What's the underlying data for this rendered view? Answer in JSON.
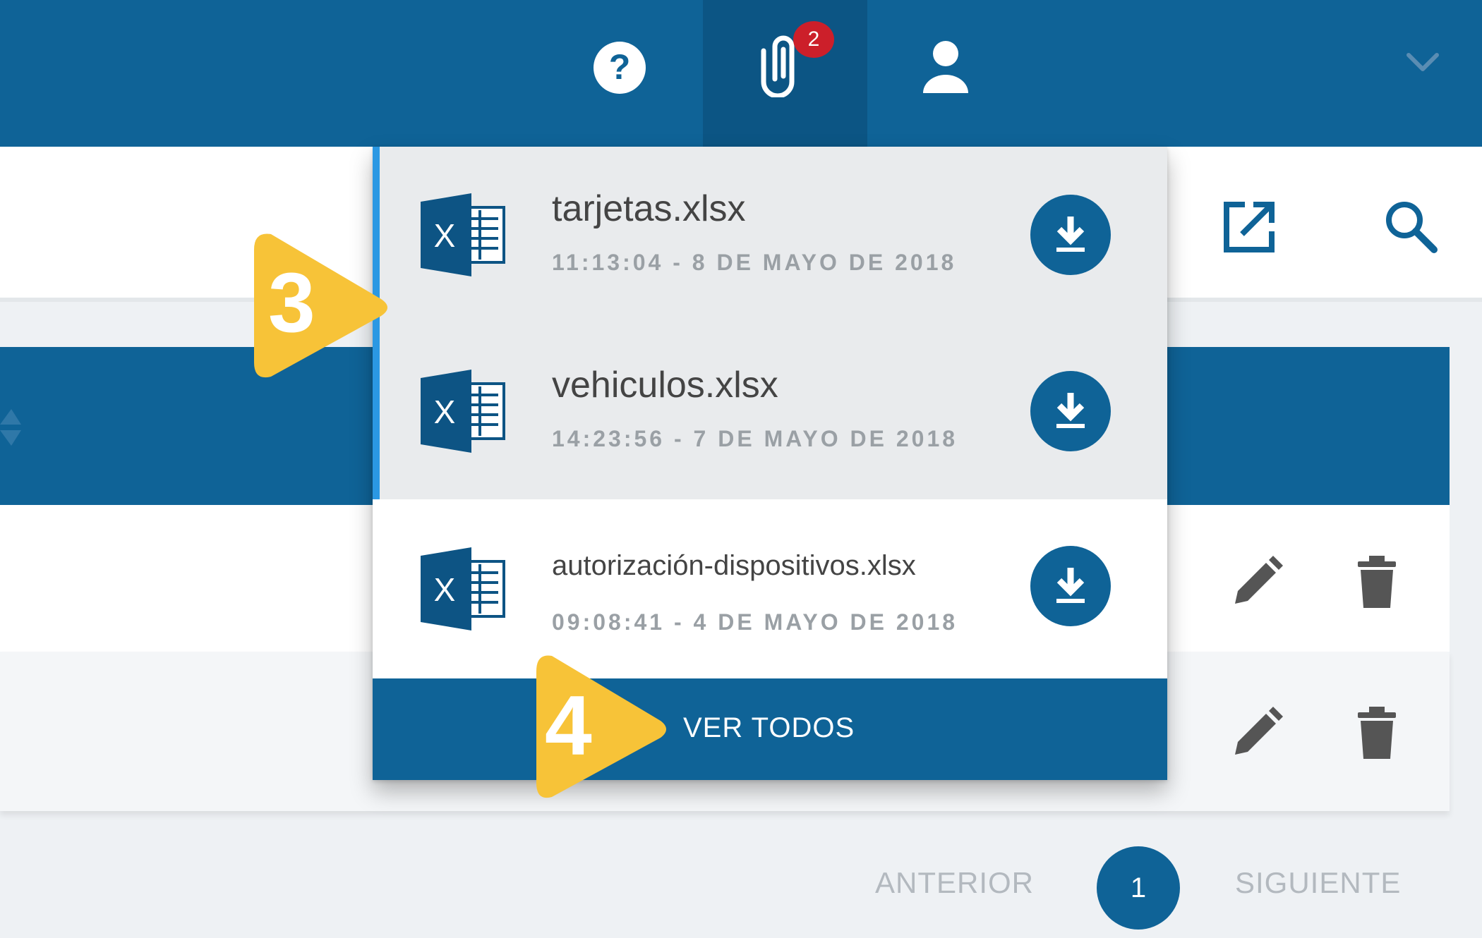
{
  "header": {
    "help_icon": "help-circle-icon",
    "attachments_icon": "paperclip-icon",
    "attachments_badge": "2",
    "user_icon": "user-icon",
    "menu_icon": "chevron-down-icon"
  },
  "toolbar": {
    "open_icon": "open-external-icon",
    "search_icon": "search-icon"
  },
  "downloads": {
    "items": [
      {
        "name": "tarjetas.xlsx",
        "timestamp": "11:13:04 - 8 DE MAYO DE 2018",
        "unread": true
      },
      {
        "name": "vehiculos.xlsx",
        "timestamp": "14:23:56 - 7 DE MAYO DE 2018",
        "unread": true
      },
      {
        "name": "autorización-dispositivos.xlsx",
        "timestamp": "09:08:41 - 4 DE MAYO DE 2018",
        "unread": false
      }
    ],
    "view_all_label": "VER TODOS"
  },
  "callouts": {
    "first": "3",
    "second": "4"
  },
  "pagination": {
    "prev_label": "ANTERIOR",
    "current_page": "1",
    "next_label": "SIGUIENTE"
  },
  "colors": {
    "primary": "#0f6397",
    "badge": "#cc1f2a",
    "unread_bar": "#2b98e3",
    "callout": "#f7c338"
  }
}
